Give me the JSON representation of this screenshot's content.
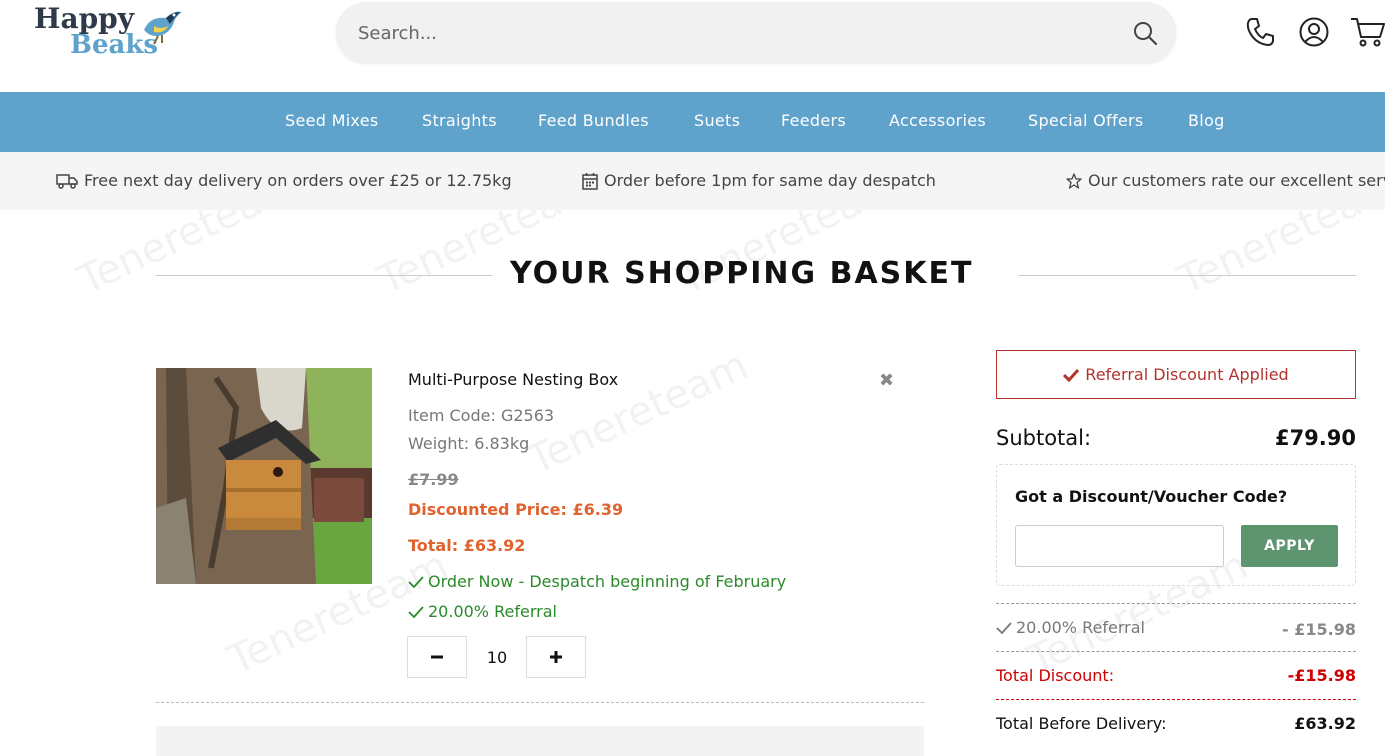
{
  "brand": {
    "line1": "Happy",
    "line2": "Beaks"
  },
  "search": {
    "placeholder": "Search..."
  },
  "header_icons": [
    "phone-icon",
    "account-icon",
    "cart-icon"
  ],
  "nav": {
    "items": [
      "Seed Mixes",
      "Straights",
      "Feed Bundles",
      "Suets",
      "Feeders",
      "Accessories",
      "Special Offers",
      "Blog"
    ]
  },
  "info_bar": {
    "items": [
      {
        "icon": "truck-icon",
        "text": "Free next day delivery on orders over £25 or 12.75kg"
      },
      {
        "icon": "calendar-icon",
        "text": "Order before 1pm for same day despatch"
      },
      {
        "icon": "star-icon",
        "text": "Our customers rate our excellent serv"
      }
    ]
  },
  "page": {
    "title": "YOUR SHOPPING BASKET"
  },
  "product": {
    "name": "Multi-Purpose Nesting Box",
    "item_code": "Item Code: G2563",
    "weight": "Weight: 6.83kg",
    "old_price": "£7.99",
    "discounted_price": "Discounted Price: £6.39",
    "total": "Total: £63.92",
    "despatch": "Order Now - Despatch beginning of February",
    "referral": "20.00% Referral",
    "quantity": "10",
    "remove_symbol": "✖"
  },
  "summary": {
    "referral_applied": "Referral Discount Applied",
    "subtotal_label": "Subtotal:",
    "subtotal_value": "£79.90",
    "voucher_label": "Got a Discount/Voucher Code?",
    "apply_label": "APPLY",
    "referral_label": "20.00% Referral",
    "referral_value": "- £15.98",
    "total_discount_label": "Total Discount:",
    "total_discount_value": "-£15.98",
    "before_delivery_label": "Total Before Delivery:",
    "before_delivery_value": "£63.92"
  },
  "watermark": {
    "text": "Tenereteam"
  },
  "colors": {
    "nav": "#5fa3cc",
    "discount_orange": "#e0622e",
    "green": "#2a8a2a",
    "referral_red": "#b3322d",
    "apply_green": "#5e9470",
    "total_discount_red": "#cc0000"
  }
}
